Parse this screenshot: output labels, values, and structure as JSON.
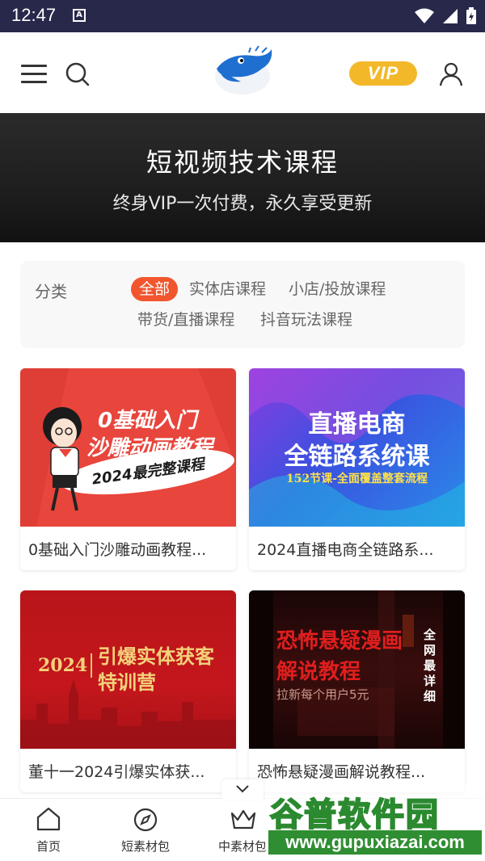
{
  "status_bar": {
    "time": "12:47",
    "a_icon": "A"
  },
  "header": {
    "vip_label": "VIP"
  },
  "banner": {
    "title": "短视频技术课程",
    "subtitle": "终身VIP一次付费，永久享受更新"
  },
  "filter": {
    "label": "分类",
    "chips": [
      "全部",
      "实体店课程",
      "小店/投放课程",
      "带货/直播课程",
      "抖音玩法课程"
    ],
    "active_index": 0,
    "active_color": "#f1562e"
  },
  "courses": [
    {
      "title": "0基础入门沙雕动画教程...",
      "thumb": {
        "line1": "0基础入门",
        "line2": "沙雕动画教程",
        "tag": "2024最完整课程",
        "bg": "#e8453c"
      }
    },
    {
      "title": "2024直播电商全链路系...",
      "thumb": {
        "line1": "直播电商",
        "line2": "全链路系统课",
        "tag": "152节课-全面覆盖整套流程",
        "bg": "#5b4fd8"
      }
    },
    {
      "title": "董十一2024引爆实体获...",
      "thumb": {
        "year": "2024",
        "line1": "引爆实体获客",
        "line2": "特训营",
        "bg": "#c4161c"
      }
    },
    {
      "title": "恐怖悬疑漫画解说教程...",
      "thumb": {
        "line1": "恐怖悬疑漫画",
        "line2": "解说教程",
        "sub": "拉新每个用户5元",
        "side": "全网最详细",
        "bg": "#2a0b0b"
      }
    }
  ],
  "tabbar": {
    "tabs": [
      {
        "label": "首页",
        "icon": "home-icon"
      },
      {
        "label": "短素材包",
        "icon": "compass-icon"
      },
      {
        "label": "中素材包",
        "icon": "crown-icon"
      }
    ]
  },
  "watermark": {
    "main": "谷普软件园",
    "url": "www.gupuxiazai.com"
  }
}
